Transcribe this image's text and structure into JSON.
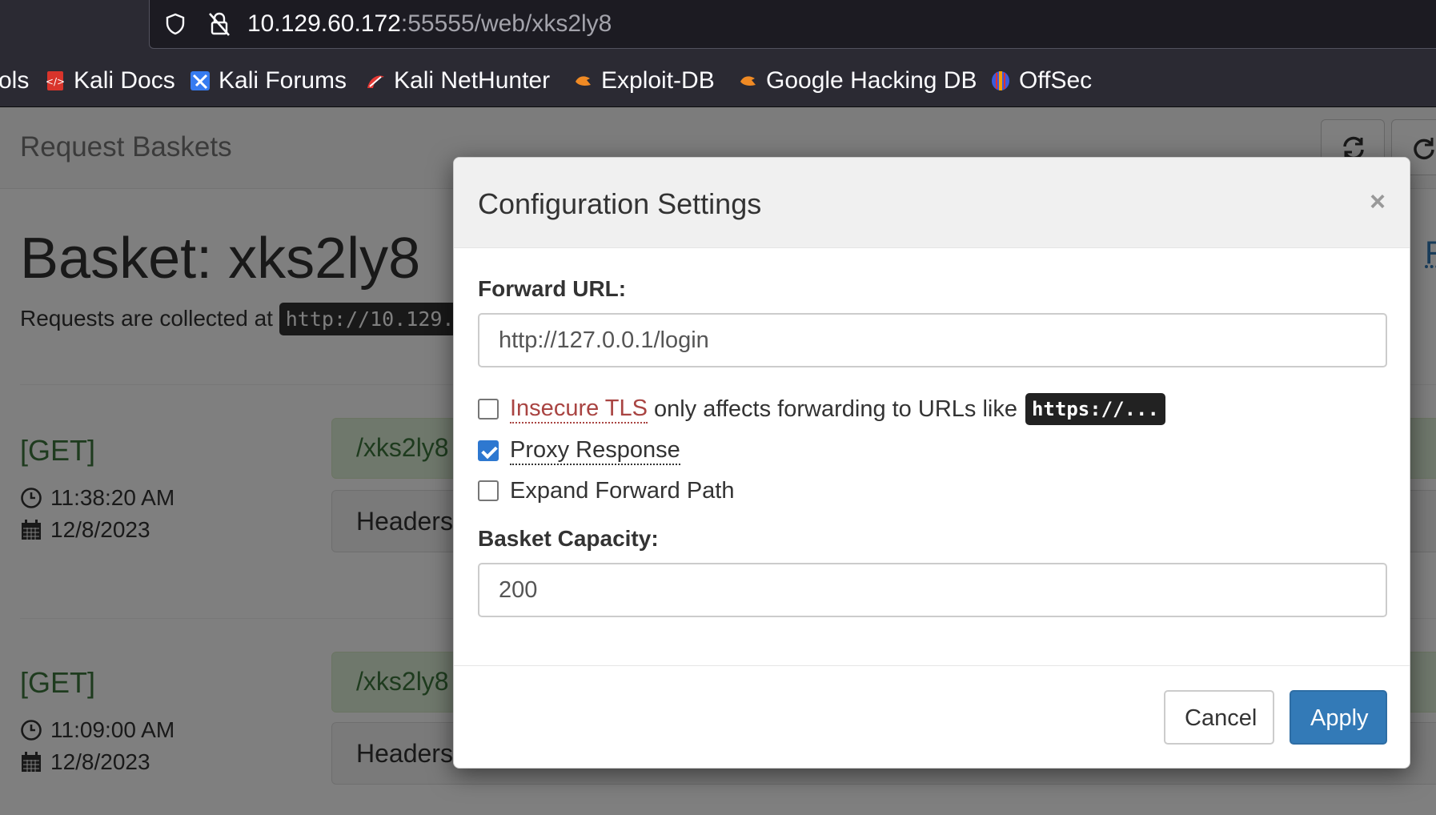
{
  "browser": {
    "url_host": "10.129.60.172",
    "url_rest": ":55555/web/xks2ly8",
    "bookmarks": [
      {
        "label": "ols"
      },
      {
        "label": "Kali Docs"
      },
      {
        "label": "Kali Forums"
      },
      {
        "label": "Kali NetHunter"
      },
      {
        "label": "Exploit-DB"
      },
      {
        "label": "Google Hacking DB"
      },
      {
        "label": "OffSec"
      }
    ]
  },
  "page": {
    "brand": "Request Baskets",
    "basket_title": "Basket: xks2ly8",
    "collected_prefix": "Requests are collected at",
    "collected_url": "http://10.129.",
    "right_fragment": "F",
    "requests": [
      {
        "method": "[GET]",
        "time": "11:38:20 AM",
        "date": "12/8/2023",
        "path": "/xks2ly8",
        "headers": "Headers"
      },
      {
        "method": "[GET]",
        "time": "11:09:00 AM",
        "date": "12/8/2023",
        "path": "/xks2ly8",
        "headers": "Headers"
      }
    ]
  },
  "modal": {
    "title": "Configuration Settings",
    "close": "×",
    "forward_url_label": "Forward URL:",
    "forward_url_value": "http://127.0.0.1/login",
    "insecure_tls_label": "Insecure TLS",
    "insecure_tls_suffix": "only affects forwarding to URLs like",
    "insecure_tls_code": "https://...",
    "insecure_tls_checked": false,
    "proxy_response_label": "Proxy Response",
    "proxy_response_checked": true,
    "expand_path_label": "Expand Forward Path",
    "expand_path_checked": false,
    "capacity_label": "Basket Capacity:",
    "capacity_value": "200",
    "cancel_label": "Cancel",
    "apply_label": "Apply"
  }
}
